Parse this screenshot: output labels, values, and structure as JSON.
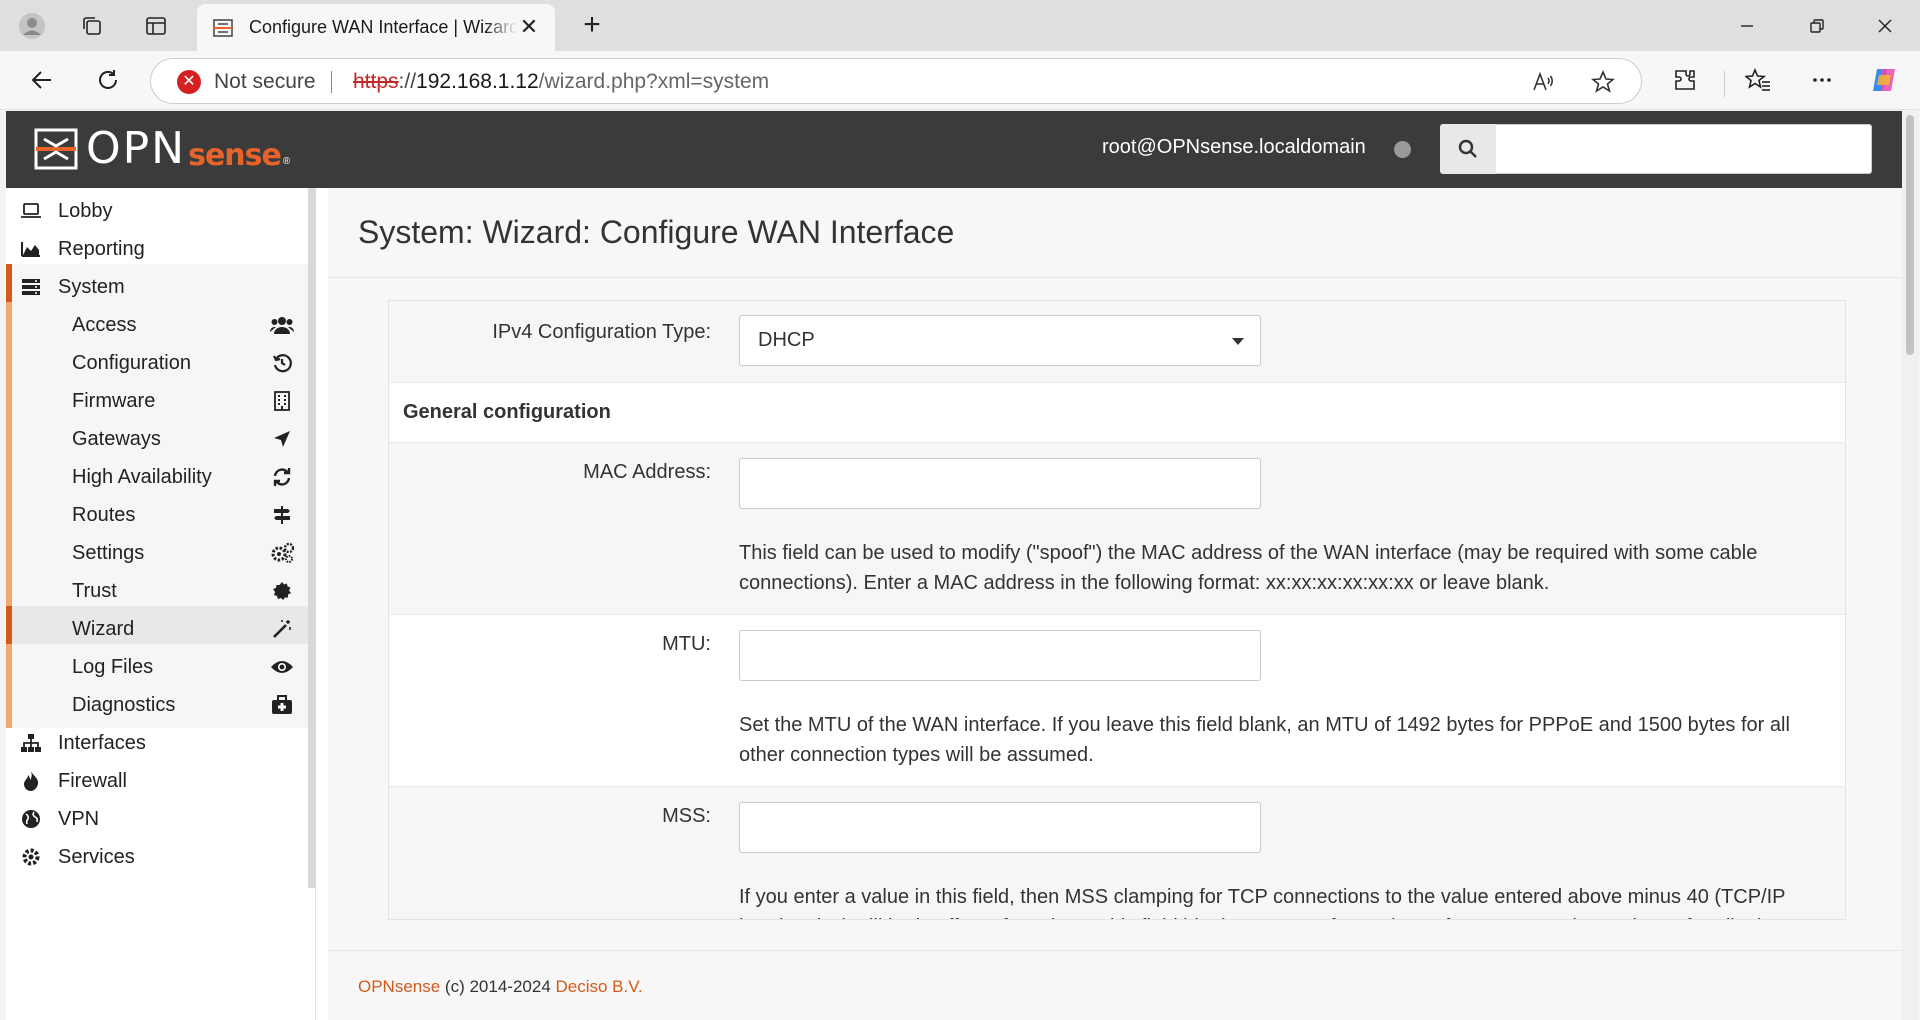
{
  "browser": {
    "tab_title": "Configure WAN Interface | Wizard | OPNsense",
    "new_tab_glyph": "+",
    "close_tab_glyph": "✕",
    "security_label": "Not secure",
    "url_scheme": "https",
    "url_sep": "://",
    "url_host": "192.168.1.12",
    "url_path": "/wizard.php?xml=system",
    "window_controls": {
      "minimize": "—",
      "restore": "❐",
      "close": "✕"
    }
  },
  "header": {
    "logo_opn": "OPN",
    "logo_sense": "sense",
    "logo_reg": "®",
    "user": "root@OPNsense.localdomain",
    "search_placeholder": ""
  },
  "sidebar": {
    "top_items": [
      {
        "label": "Lobby",
        "icon": "laptop-icon"
      },
      {
        "label": "Reporting",
        "icon": "area-chart-icon"
      },
      {
        "label": "System",
        "icon": "server-icon"
      }
    ],
    "system_items": [
      {
        "label": "Access",
        "icon": "users-icon"
      },
      {
        "label": "Configuration",
        "icon": "history-icon"
      },
      {
        "label": "Firmware",
        "icon": "building-icon"
      },
      {
        "label": "Gateways",
        "icon": "location-arrow-icon"
      },
      {
        "label": "High Availability",
        "icon": "refresh-icon"
      },
      {
        "label": "Routes",
        "icon": "map-signs-icon"
      },
      {
        "label": "Settings",
        "icon": "cogs-icon"
      },
      {
        "label": "Trust",
        "icon": "certificate-icon"
      },
      {
        "label": "Wizard",
        "icon": "magic-wand-icon",
        "active": true
      },
      {
        "label": "Log Files",
        "icon": "eye-icon"
      },
      {
        "label": "Diagnostics",
        "icon": "medkit-icon"
      }
    ],
    "bottom_items": [
      {
        "label": "Interfaces",
        "icon": "sitemap-icon"
      },
      {
        "label": "Firewall",
        "icon": "fire-icon"
      },
      {
        "label": "VPN",
        "icon": "globe-icon"
      },
      {
        "label": "Services",
        "icon": "cog-icon"
      }
    ]
  },
  "main": {
    "title": "System: Wizard: Configure WAN Interface",
    "ipv4_label": "IPv4 Configuration Type:",
    "ipv4_value": "DHCP",
    "general_heading": "General configuration",
    "mac_label": "MAC Address:",
    "mac_value": "",
    "mac_help": "This field can be used to modify (\"spoof\") the MAC address of the WAN interface (may be required with some cable connections). Enter a MAC address in the following format: xx:xx:xx:xx:xx:xx or leave blank.",
    "mtu_label": "MTU:",
    "mtu_value": "",
    "mtu_help": "Set the MTU of the WAN interface. If you leave this field blank, an MTU of 1492 bytes for PPPoE and 1500 bytes for all other connection types will be assumed.",
    "mss_label": "MSS:",
    "mss_value": "",
    "mss_help": "If you enter a value in this field, then MSS clamping for TCP connections to the value entered above minus 40 (TCP/IP header size) will be in effect. If you leave this field blank, an MSS of 1492 bytes for PPPoE and 1500 bytes for all other connection types will be assumed."
  },
  "footer": {
    "brand": "OPNsense",
    "copyright": " (c) 2014-2024 ",
    "company": "Deciso B.V."
  }
}
